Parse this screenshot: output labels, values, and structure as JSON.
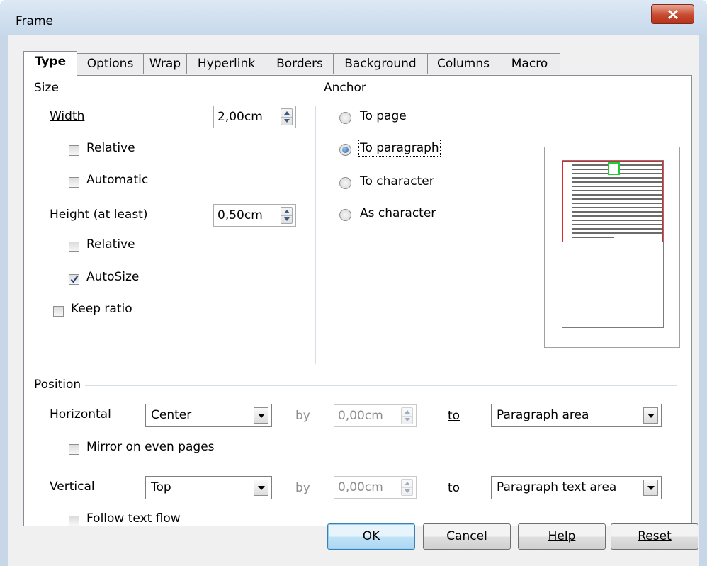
{
  "window": {
    "title": "Frame"
  },
  "tabs": [
    "Type",
    "Options",
    "Wrap",
    "Hyperlink",
    "Borders",
    "Background",
    "Columns",
    "Macro"
  ],
  "size": {
    "group_label": "Size",
    "width_label": "Width",
    "width_value": "2,00cm",
    "width_relative_label": "Relative",
    "width_relative_checked": false,
    "width_automatic_label": "Automatic",
    "width_automatic_checked": false,
    "height_label": "Height (at least)",
    "height_value": "0,50cm",
    "height_relative_label": "Relative",
    "height_relative_checked": false,
    "autosize_label": "AutoSize",
    "autosize_checked": true,
    "keep_ratio_label": "Keep ratio",
    "keep_ratio_checked": false
  },
  "anchor": {
    "group_label": "Anchor",
    "options": [
      "To page",
      "To paragraph",
      "To character",
      "As character"
    ],
    "selected": "To paragraph"
  },
  "position": {
    "group_label": "Position",
    "horizontal_label": "Horizontal",
    "horizontal_value": "Center",
    "horizontal_by_label": "by",
    "horizontal_by_value": "0,00cm",
    "horizontal_to_label": "to",
    "horizontal_to_value": "Paragraph area",
    "mirror_label": "Mirror on even pages",
    "mirror_checked": false,
    "vertical_label": "Vertical",
    "vertical_value": "Top",
    "vertical_by_label": "by",
    "vertical_by_value": "0,00cm",
    "vertical_to_label": "to",
    "vertical_to_value": "Paragraph text area",
    "follow_label": "Follow text flow",
    "follow_checked": false
  },
  "buttons": {
    "ok": "OK",
    "cancel": "Cancel",
    "help": "Help",
    "reset": "Reset"
  },
  "colors": {
    "paragraph_border": "#e0252f",
    "frame_marker": "#1fcc33",
    "radio_dot": "#1e5fae"
  }
}
